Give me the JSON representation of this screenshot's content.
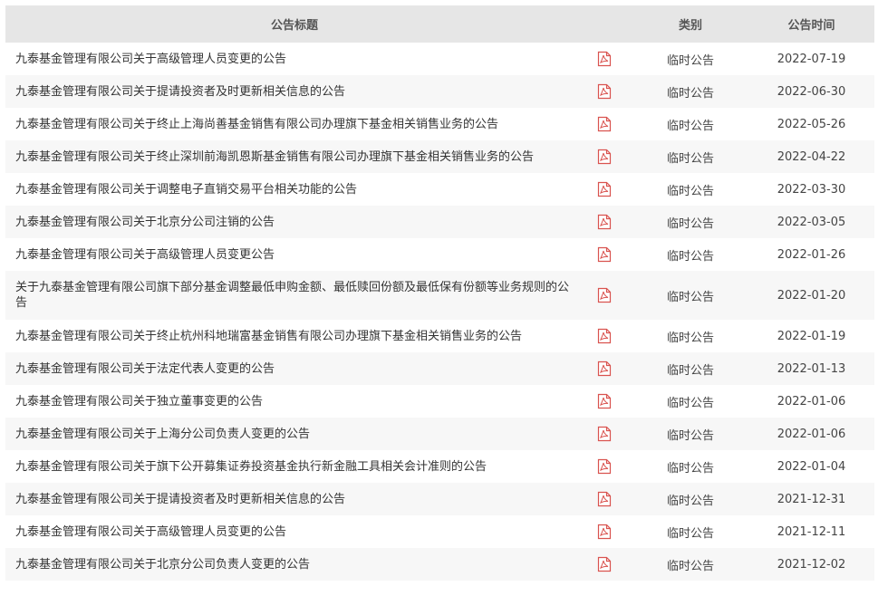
{
  "table": {
    "headers": {
      "title": "公告标题",
      "category": "类别",
      "date": "公告时间"
    },
    "icon_name": "pdf-icon",
    "icon_color": "#d9534f",
    "rows": [
      {
        "title": "九泰基金管理有限公司关于高级管理人员变更的公告",
        "category": "临时公告",
        "date": "2022-07-19"
      },
      {
        "title": "九泰基金管理有限公司关于提请投资者及时更新相关信息的公告",
        "category": "临时公告",
        "date": "2022-06-30"
      },
      {
        "title": "九泰基金管理有限公司关于终止上海尚善基金销售有限公司办理旗下基金相关销售业务的公告",
        "category": "临时公告",
        "date": "2022-05-26"
      },
      {
        "title": "九泰基金管理有限公司关于终止深圳前海凯恩斯基金销售有限公司办理旗下基金相关销售业务的公告",
        "category": "临时公告",
        "date": "2022-04-22"
      },
      {
        "title": "九泰基金管理有限公司关于调整电子直销交易平台相关功能的公告",
        "category": "临时公告",
        "date": "2022-03-30"
      },
      {
        "title": "九泰基金管理有限公司关于北京分公司注销的公告",
        "category": "临时公告",
        "date": "2022-03-05"
      },
      {
        "title": "九泰基金管理有限公司关于高级管理人员变更公告",
        "category": "临时公告",
        "date": "2022-01-26"
      },
      {
        "title": "关于九泰基金管理有限公司旗下部分基金调整最低申购金额、最低赎回份额及最低保有份额等业务规则的公告",
        "category": "临时公告",
        "date": "2022-01-20"
      },
      {
        "title": "九泰基金管理有限公司关于终止杭州科地瑞富基金销售有限公司办理旗下基金相关销售业务的公告",
        "category": "临时公告",
        "date": "2022-01-19"
      },
      {
        "title": "九泰基金管理有限公司关于法定代表人变更的公告",
        "category": "临时公告",
        "date": "2022-01-13"
      },
      {
        "title": "九泰基金管理有限公司关于独立董事变更的公告",
        "category": "临时公告",
        "date": "2022-01-06"
      },
      {
        "title": "九泰基金管理有限公司关于上海分公司负责人变更的公告",
        "category": "临时公告",
        "date": "2022-01-06"
      },
      {
        "title": "九泰基金管理有限公司关于旗下公开募集证券投资基金执行新金融工具相关会计准则的公告",
        "category": "临时公告",
        "date": "2022-01-04"
      },
      {
        "title": "九泰基金管理有限公司关于提请投资者及时更新相关信息的公告",
        "category": "临时公告",
        "date": "2021-12-31"
      },
      {
        "title": "九泰基金管理有限公司关于高级管理人员变更的公告",
        "category": "临时公告",
        "date": "2021-12-11"
      },
      {
        "title": "九泰基金管理有限公司关于北京分公司负责人变更的公告",
        "category": "临时公告",
        "date": "2021-12-02"
      }
    ]
  }
}
